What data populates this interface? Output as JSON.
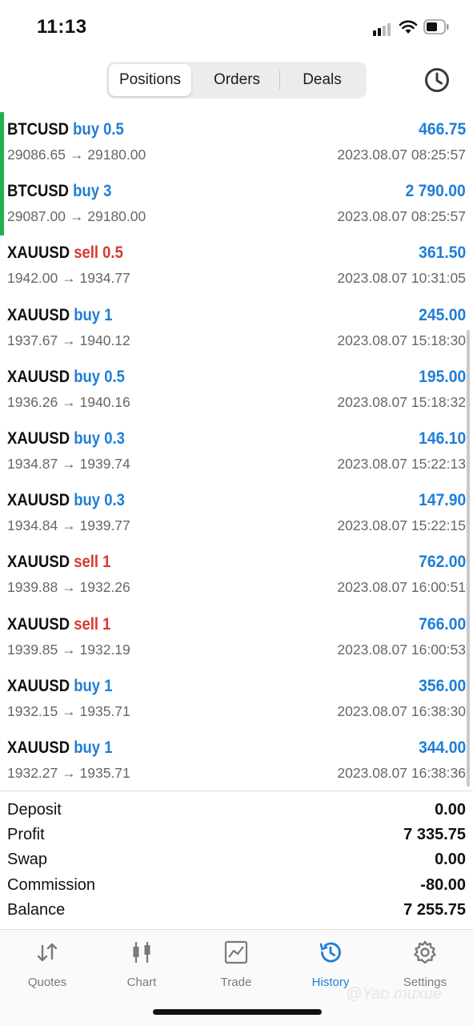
{
  "status_bar": {
    "time": "11:13"
  },
  "tabs_top": {
    "positions": "Positions",
    "orders": "Orders",
    "deals": "Deals",
    "active": "positions"
  },
  "deals": [
    {
      "symbol": "BTCUSD",
      "side": "buy",
      "volume": "0.5",
      "open": "29086.65",
      "close": "29180.00",
      "profit": "466.75",
      "time": "2023.08.07 08:25:57",
      "accent": true
    },
    {
      "symbol": "BTCUSD",
      "side": "buy",
      "volume": "3",
      "open": "29087.00",
      "close": "29180.00",
      "profit": "2 790.00",
      "time": "2023.08.07 08:25:57",
      "accent": true
    },
    {
      "symbol": "XAUUSD",
      "side": "sell",
      "volume": "0.5",
      "open": "1942.00",
      "close": "1934.77",
      "profit": "361.50",
      "time": "2023.08.07 10:31:05",
      "accent": false
    },
    {
      "symbol": "XAUUSD",
      "side": "buy",
      "volume": "1",
      "open": "1937.67",
      "close": "1940.12",
      "profit": "245.00",
      "time": "2023.08.07 15:18:30",
      "accent": false
    },
    {
      "symbol": "XAUUSD",
      "side": "buy",
      "volume": "0.5",
      "open": "1936.26",
      "close": "1940.16",
      "profit": "195.00",
      "time": "2023.08.07 15:18:32",
      "accent": false
    },
    {
      "symbol": "XAUUSD",
      "side": "buy",
      "volume": "0.3",
      "open": "1934.87",
      "close": "1939.74",
      "profit": "146.10",
      "time": "2023.08.07 15:22:13",
      "accent": false
    },
    {
      "symbol": "XAUUSD",
      "side": "buy",
      "volume": "0.3",
      "open": "1934.84",
      "close": "1939.77",
      "profit": "147.90",
      "time": "2023.08.07 15:22:15",
      "accent": false
    },
    {
      "symbol": "XAUUSD",
      "side": "sell",
      "volume": "1",
      "open": "1939.88",
      "close": "1932.26",
      "profit": "762.00",
      "time": "2023.08.07 16:00:51",
      "accent": false
    },
    {
      "symbol": "XAUUSD",
      "side": "sell",
      "volume": "1",
      "open": "1939.85",
      "close": "1932.19",
      "profit": "766.00",
      "time": "2023.08.07 16:00:53",
      "accent": false
    },
    {
      "symbol": "XAUUSD",
      "side": "buy",
      "volume": "1",
      "open": "1932.15",
      "close": "1935.71",
      "profit": "356.00",
      "time": "2023.08.07 16:38:30",
      "accent": false
    },
    {
      "symbol": "XAUUSD",
      "side": "buy",
      "volume": "1",
      "open": "1932.27",
      "close": "1935.71",
      "profit": "344.00",
      "time": "2023.08.07 16:38:36",
      "accent": false
    }
  ],
  "arrow": "→",
  "summary": [
    {
      "label": "Deposit",
      "value": "0.00"
    },
    {
      "label": "Profit",
      "value": "7 335.75"
    },
    {
      "label": "Swap",
      "value": "0.00"
    },
    {
      "label": "Commission",
      "value": "-80.00"
    },
    {
      "label": "Balance",
      "value": "7 255.75"
    }
  ],
  "tabbar": {
    "items": [
      {
        "label": "Quotes",
        "icon": "quotes-icon"
      },
      {
        "label": "Chart",
        "icon": "chart-icon"
      },
      {
        "label": "Trade",
        "icon": "trade-icon"
      },
      {
        "label": "History",
        "icon": "history-icon"
      },
      {
        "label": "Settings",
        "icon": "settings-icon"
      }
    ],
    "active": "History"
  },
  "watermark": "@Yao muxue",
  "colors": {
    "buy": "#1f7ed6",
    "sell": "#d83a30",
    "accent_bar": "#22b14c",
    "active_tab": "#1f7ed6"
  }
}
